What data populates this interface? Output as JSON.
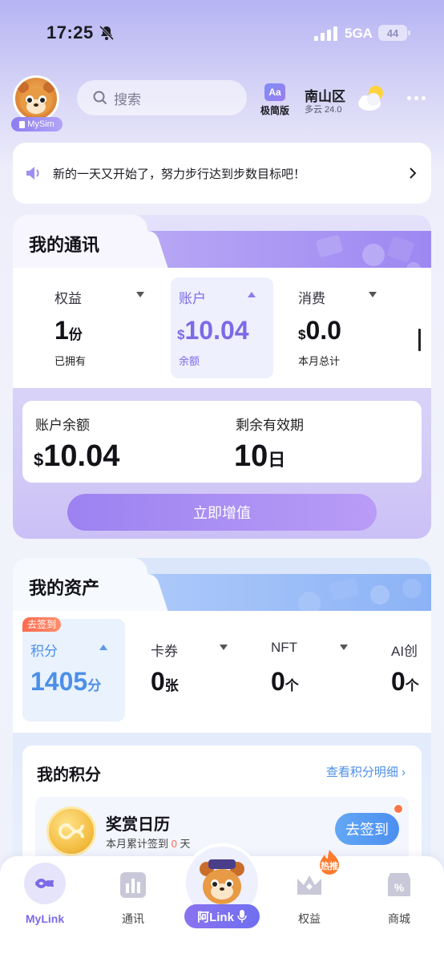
{
  "status_bar": {
    "time": "17:25",
    "network": "5GA",
    "battery": "44"
  },
  "header": {
    "avatar_tag": "MySim",
    "search_placeholder": "搜索",
    "simple_mode_icon": "Aa",
    "simple_mode_label": "极简版",
    "city": "南山区",
    "weather": "多云 24.0"
  },
  "notice": {
    "text": "新的一天又开始了，努力步行达到步数目标吧！"
  },
  "comm_card": {
    "title": "我的通讯",
    "stats": [
      {
        "label": "权益",
        "value": "1",
        "unit": "份",
        "sub": "已拥有",
        "active": false
      },
      {
        "label": "账户",
        "prefix": "$",
        "value": "10.04",
        "unit": "",
        "sub": "余额",
        "active": true
      },
      {
        "label": "消费",
        "prefix": "$",
        "value": "0.0",
        "unit": "",
        "sub": "本月总计",
        "active": false
      }
    ],
    "balance_label": "账户余额",
    "balance_prefix": "$",
    "balance_value": "10.04",
    "validity_label": "剩余有效期",
    "validity_value": "10",
    "validity_unit": "日",
    "topup_button": "立即增值"
  },
  "asset_card": {
    "title": "我的资产",
    "checkin_badge": "去签到",
    "assets": [
      {
        "label": "积分",
        "value": "1405",
        "unit": "分",
        "active": true
      },
      {
        "label": "卡券",
        "value": "0",
        "unit": "张",
        "active": false
      },
      {
        "label": "NFT",
        "value": "0",
        "unit": "个",
        "active": false
      },
      {
        "label": "AI创",
        "value": "0",
        "unit": "个",
        "active": false
      }
    ],
    "points_title": "我的积分",
    "points_link": "查看积分明细",
    "calendar_title": "奖赏日历",
    "calendar_sub_prefix": "本月累计签到",
    "calendar_sub_num": "0",
    "calendar_sub_suffix": "天",
    "checkin_button": "去签到"
  },
  "bottom_nav": {
    "items": [
      "MyLink",
      "通讯",
      "权益",
      "商城"
    ],
    "center": "阿Link",
    "hot": "热推"
  },
  "colors": {
    "accent_purple": "#7b6ae8",
    "accent_blue": "#4d8fe8",
    "alert_orange": "#ff6a4f"
  }
}
